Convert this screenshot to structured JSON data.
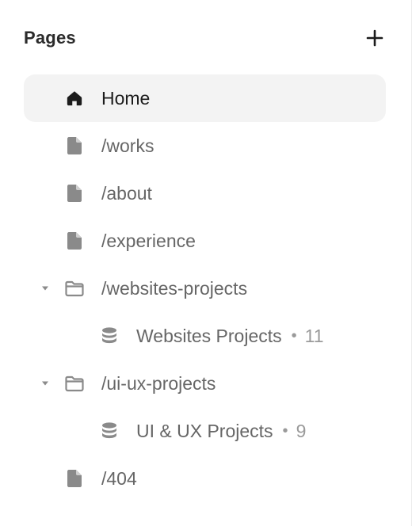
{
  "header": {
    "title": "Pages",
    "add_icon": "plus-icon"
  },
  "items": [
    {
      "label": "Home",
      "icon": "home-icon",
      "active": true
    },
    {
      "label": "/works",
      "icon": "page-icon"
    },
    {
      "label": "/about",
      "icon": "page-icon"
    },
    {
      "label": "/experience",
      "icon": "page-icon"
    },
    {
      "label": "/websites-projects",
      "icon": "folder-icon",
      "expanded": true
    },
    {
      "label": "Websites Projects",
      "icon": "database-icon",
      "count": "11",
      "sep": "•"
    },
    {
      "label": "/ui-ux-projects",
      "icon": "folder-icon",
      "expanded": true
    },
    {
      "label": "UI & UX Projects",
      "icon": "database-icon",
      "count": "9",
      "sep": "•"
    },
    {
      "label": "/404",
      "icon": "page-icon"
    }
  ],
  "colors": {
    "active_bg": "#f3f3f3",
    "icon": "#8a8a8a",
    "text": "#666666",
    "active_text": "#1c1c1c"
  }
}
